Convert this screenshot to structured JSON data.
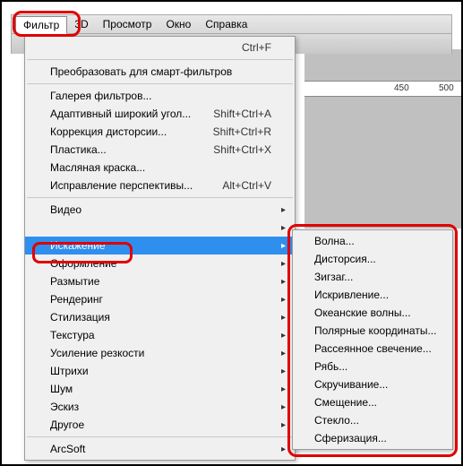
{
  "menubar": {
    "filter": "Фильтр",
    "threeD": "3D",
    "view": "Просмотр",
    "window": "Окно",
    "help": "Справка"
  },
  "ruler": {
    "t450": "450",
    "t500": "500"
  },
  "dropdown": {
    "repeat_shortcut": "Ctrl+F",
    "convert_smart": "Преобразовать для смарт-фильтров",
    "gallery": "Галерея фильтров...",
    "adaptive_wide": "Адаптивный широкий угол...",
    "adaptive_wide_sc": "Shift+Ctrl+A",
    "lens_correction": "Коррекция дисторсии...",
    "lens_correction_sc": "Shift+Ctrl+R",
    "liquify": "Пластика...",
    "liquify_sc": "Shift+Ctrl+X",
    "oil_paint": "Масляная краска...",
    "vanishing": "Исправление перспективы...",
    "vanishing_sc": "Alt+Ctrl+V",
    "video": "Видео",
    "distort": "Искажение",
    "stylize2": "Оформление",
    "blur": "Размытие",
    "render": "Рендеринг",
    "stylize": "Стилизация",
    "texture": "Текстура",
    "sharpen": "Усиление резкости",
    "strokes": "Штрихи",
    "noise": "Шум",
    "sketch": "Эскиз",
    "other": "Другое",
    "arcsoft": "ArcSoft"
  },
  "submenu": {
    "wave": "Волна...",
    "distortion": "Дисторсия...",
    "zigzag": "Зигзаг...",
    "curvature": "Искривление...",
    "ocean": "Океанские волны...",
    "polar": "Полярные координаты...",
    "diffuse_glow": "Рассеянное свечение...",
    "ripple": "Рябь...",
    "twirl": "Скручивание...",
    "displace": "Смещение...",
    "glass": "Стекло...",
    "spherize": "Сферизация..."
  }
}
